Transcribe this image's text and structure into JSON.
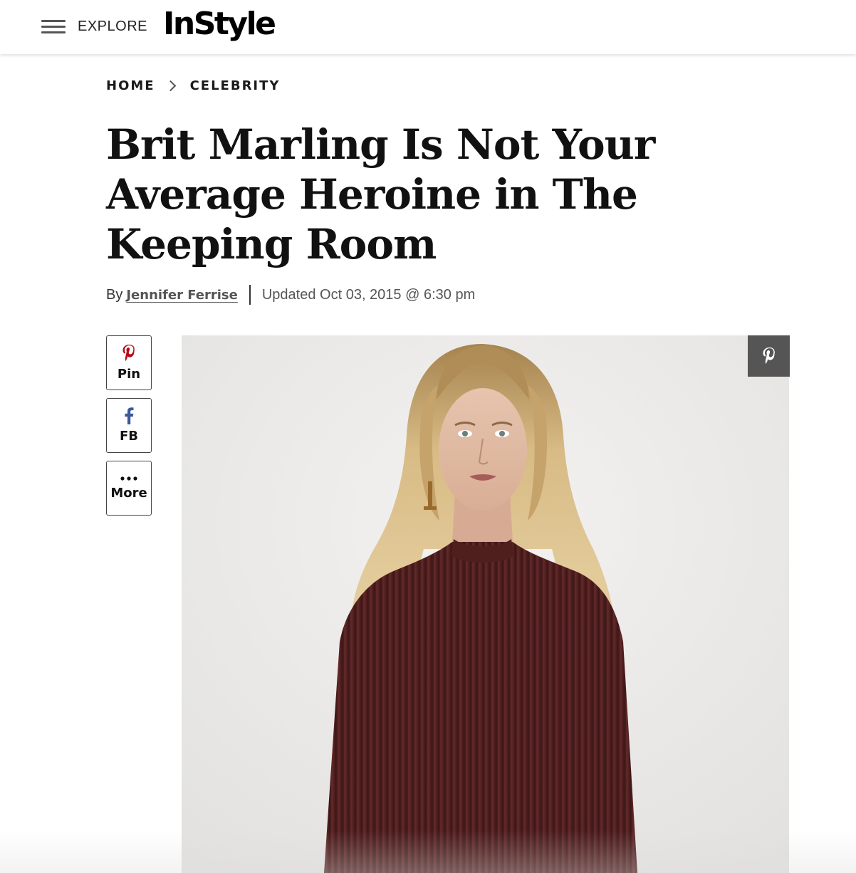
{
  "header": {
    "menu_label": "EXPLORE",
    "logo_text": "InStyle"
  },
  "breadcrumb": {
    "items": [
      "HOME",
      "CELEBRITY"
    ]
  },
  "article": {
    "title": "Brit Marling Is Not Your Average Heroine in The Keeping Room",
    "byline_prefix": "By",
    "author": "Jennifer Ferrise",
    "updated": "Updated Oct 03, 2015 @ 6:30 pm"
  },
  "share": {
    "pin_label": "Pin",
    "fb_label": "FB",
    "more_label": "More"
  },
  "colors": {
    "pinterest": "#b7081b",
    "facebook": "#3b5998",
    "sweater": "#5a2322",
    "hair": "#c9a56a",
    "background": "#ecebea"
  },
  "icons": {
    "menu": "hamburger-icon",
    "pin": "pinterest-icon",
    "fb": "facebook-icon",
    "more": "more-dots-icon",
    "pin_overlay": "pinterest-icon"
  }
}
